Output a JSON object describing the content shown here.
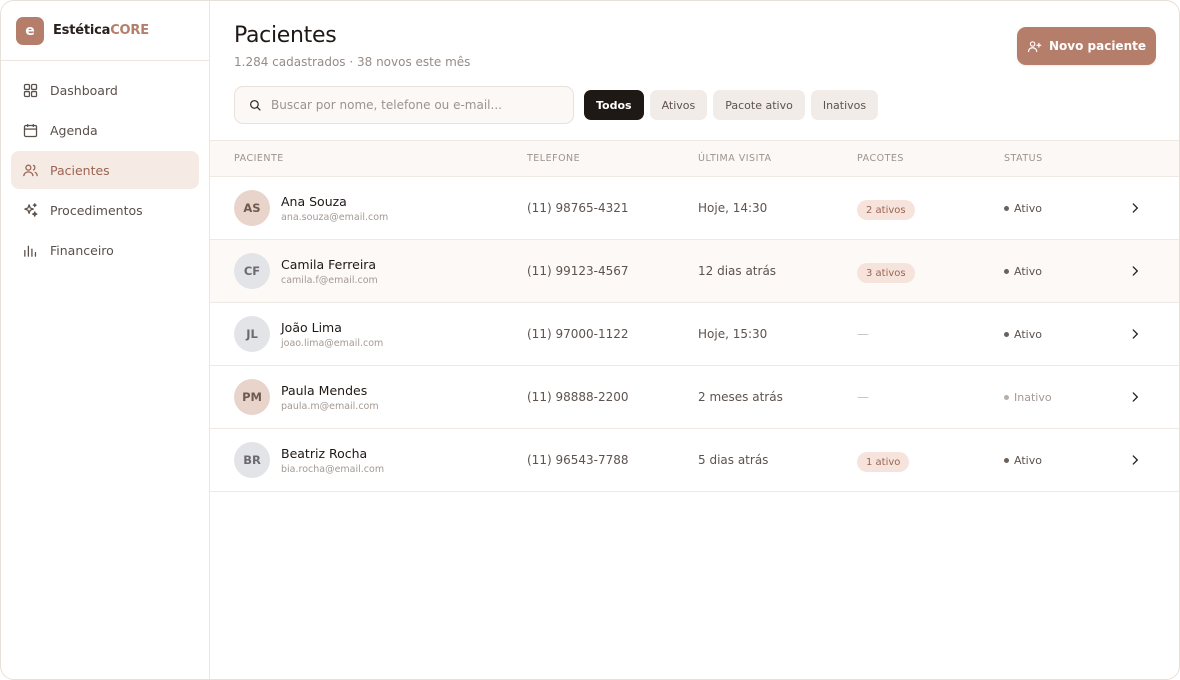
{
  "brand": {
    "logo_letter": "e",
    "name_part1": "Estética",
    "name_part2": "CORE",
    "accent": "#b57e6b"
  },
  "sidebar": {
    "items": [
      {
        "label": "Dashboard",
        "icon": "grid-icon",
        "active": false
      },
      {
        "label": "Agenda",
        "icon": "calendar-icon",
        "active": false
      },
      {
        "label": "Pacientes",
        "icon": "users-icon",
        "active": true
      },
      {
        "label": "Procedimentos",
        "icon": "sparkles-icon",
        "active": false
      },
      {
        "label": "Financeiro",
        "icon": "bar-chart-icon",
        "active": false
      }
    ]
  },
  "header": {
    "title": "Pacientes",
    "subtitle": "1.284 cadastrados · 38 novos este mês",
    "new_button": "Novo paciente"
  },
  "search": {
    "placeholder": "Buscar por nome, telefone ou e-mail...",
    "value": ""
  },
  "filters": [
    {
      "label": "Todos",
      "active": true
    },
    {
      "label": "Ativos",
      "active": false
    },
    {
      "label": "Pacote ativo",
      "active": false
    },
    {
      "label": "Inativos",
      "active": false
    }
  ],
  "table": {
    "columns": [
      "PACIENTE",
      "TELEFONE",
      "ÚLTIMA VISITA",
      "PACOTES",
      "STATUS"
    ],
    "rows": [
      {
        "initials": "AS",
        "name": "Ana Souza",
        "email": "ana.souza@email.com",
        "phone": "(11) 98765-4321",
        "last_visit": "Hoje, 14:30",
        "packages": "2 ativos",
        "status": "Ativo"
      },
      {
        "initials": "CF",
        "name": "Camila Ferreira",
        "email": "camila.f@email.com",
        "phone": "(11) 99123-4567",
        "last_visit": "12 dias atrás",
        "packages": "3 ativos",
        "status": "Ativo"
      },
      {
        "initials": "JL",
        "name": "João Lima",
        "email": "joao.lima@email.com",
        "phone": "(11) 97000-1122",
        "last_visit": "Hoje, 15:30",
        "packages": "—",
        "status": "Ativo"
      },
      {
        "initials": "PM",
        "name": "Paula Mendes",
        "email": "paula.m@email.com",
        "phone": "(11) 98888-2200",
        "last_visit": "2 meses atrás",
        "packages": "—",
        "status": "Inativo"
      },
      {
        "initials": "BR",
        "name": "Beatriz Rocha",
        "email": "bia.rocha@email.com",
        "phone": "(11) 96543-7788",
        "last_visit": "5 dias atrás",
        "packages": "1 ativo",
        "status": "Ativo"
      }
    ]
  }
}
